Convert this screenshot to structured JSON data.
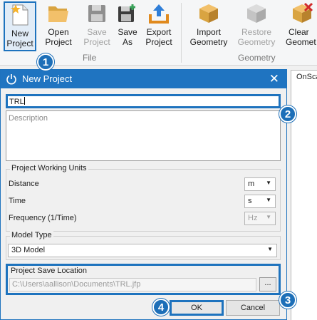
{
  "ribbon": {
    "buttons": [
      {
        "line1": "New",
        "line2": "Project",
        "icon": "new-document-icon"
      },
      {
        "line1": "Open",
        "line2": "Project",
        "icon": "folder-icon"
      },
      {
        "line1": "Save",
        "line2": "Project",
        "icon": "save-icon"
      },
      {
        "line1": "Save",
        "line2": "As",
        "icon": "save-as-icon"
      },
      {
        "line1": "Export",
        "line2": "Project",
        "icon": "export-icon"
      },
      {
        "line1": "Import",
        "line2": "Geometry",
        "icon": "import-geometry-icon"
      },
      {
        "line1": "Restore",
        "line2": "Geometry",
        "icon": "restore-geometry-icon"
      },
      {
        "line1": "Clear",
        "line2": "Geomet",
        "icon": "clear-geometry-icon"
      }
    ],
    "groups": {
      "file": "File",
      "geometry": "Geometry"
    }
  },
  "callouts": [
    "1",
    "2",
    "3",
    "4"
  ],
  "background_tab": "OnSca",
  "dialog": {
    "title": "New Project",
    "close_glyph": "✕",
    "name_value": "TRL",
    "description_placeholder": "Description",
    "units": {
      "title": "Project Working Units",
      "distance_label": "Distance",
      "distance_value": "m",
      "time_label": "Time",
      "time_value": "s",
      "frequency_label": "Frequency (1/Time)",
      "frequency_value": "Hz"
    },
    "model_type": {
      "title": "Model Type",
      "value": "3D Model"
    },
    "save_location": {
      "title": "Project Save Location",
      "path": "C:\\Users\\aallison\\Documents\\TRL.jfp",
      "browse_label": "..."
    },
    "ok_label": "OK",
    "cancel_label": "Cancel"
  },
  "colors": {
    "accent": "#1e73be",
    "titlebar": "#1f74c1",
    "callout": "#1d6fb8"
  }
}
